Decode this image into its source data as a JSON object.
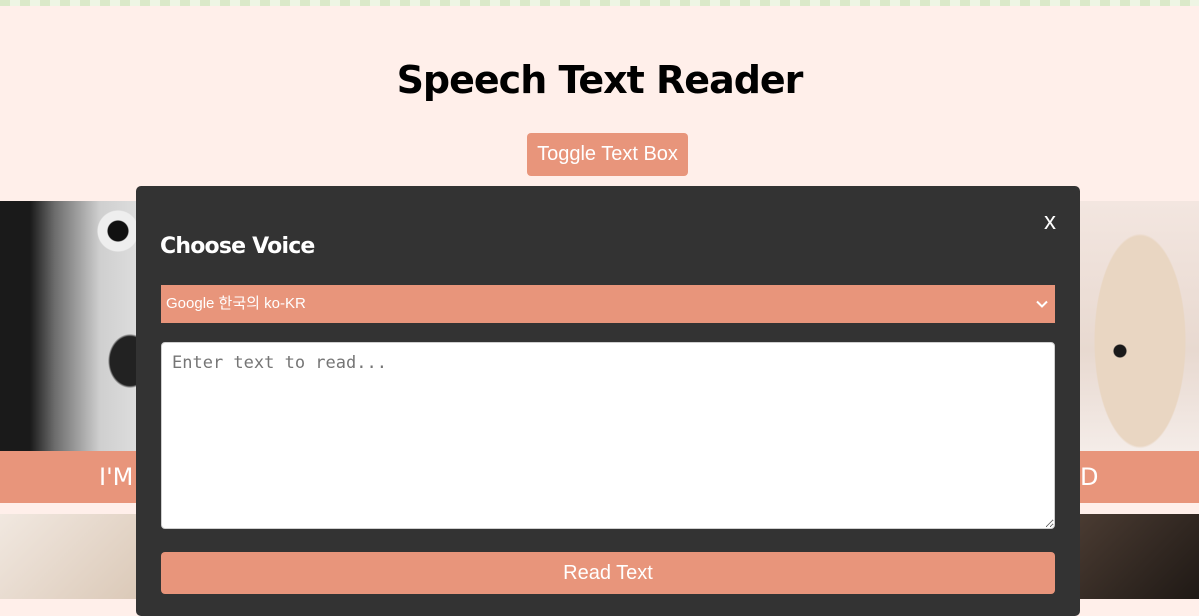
{
  "header": {
    "title": "Speech Text Reader",
    "toggle_label": "Toggle Text Box"
  },
  "cards": [
    {
      "label": "I'M",
      "image": "boy-surprised-photo"
    },
    {
      "label": "D",
      "image": "teddy-bear-photo"
    }
  ],
  "modal": {
    "close_label": "x",
    "heading": "Choose Voice",
    "voice_select": {
      "selected": "Google 한국의 ko-KR",
      "icon": "chevron-down-icon"
    },
    "text_input": {
      "value": "",
      "placeholder": "Enter text to read..."
    },
    "read_label": "Read Text"
  },
  "colors": {
    "page_background": "#ffefea",
    "accent": "#e8957b",
    "modal_background": "#333333"
  }
}
